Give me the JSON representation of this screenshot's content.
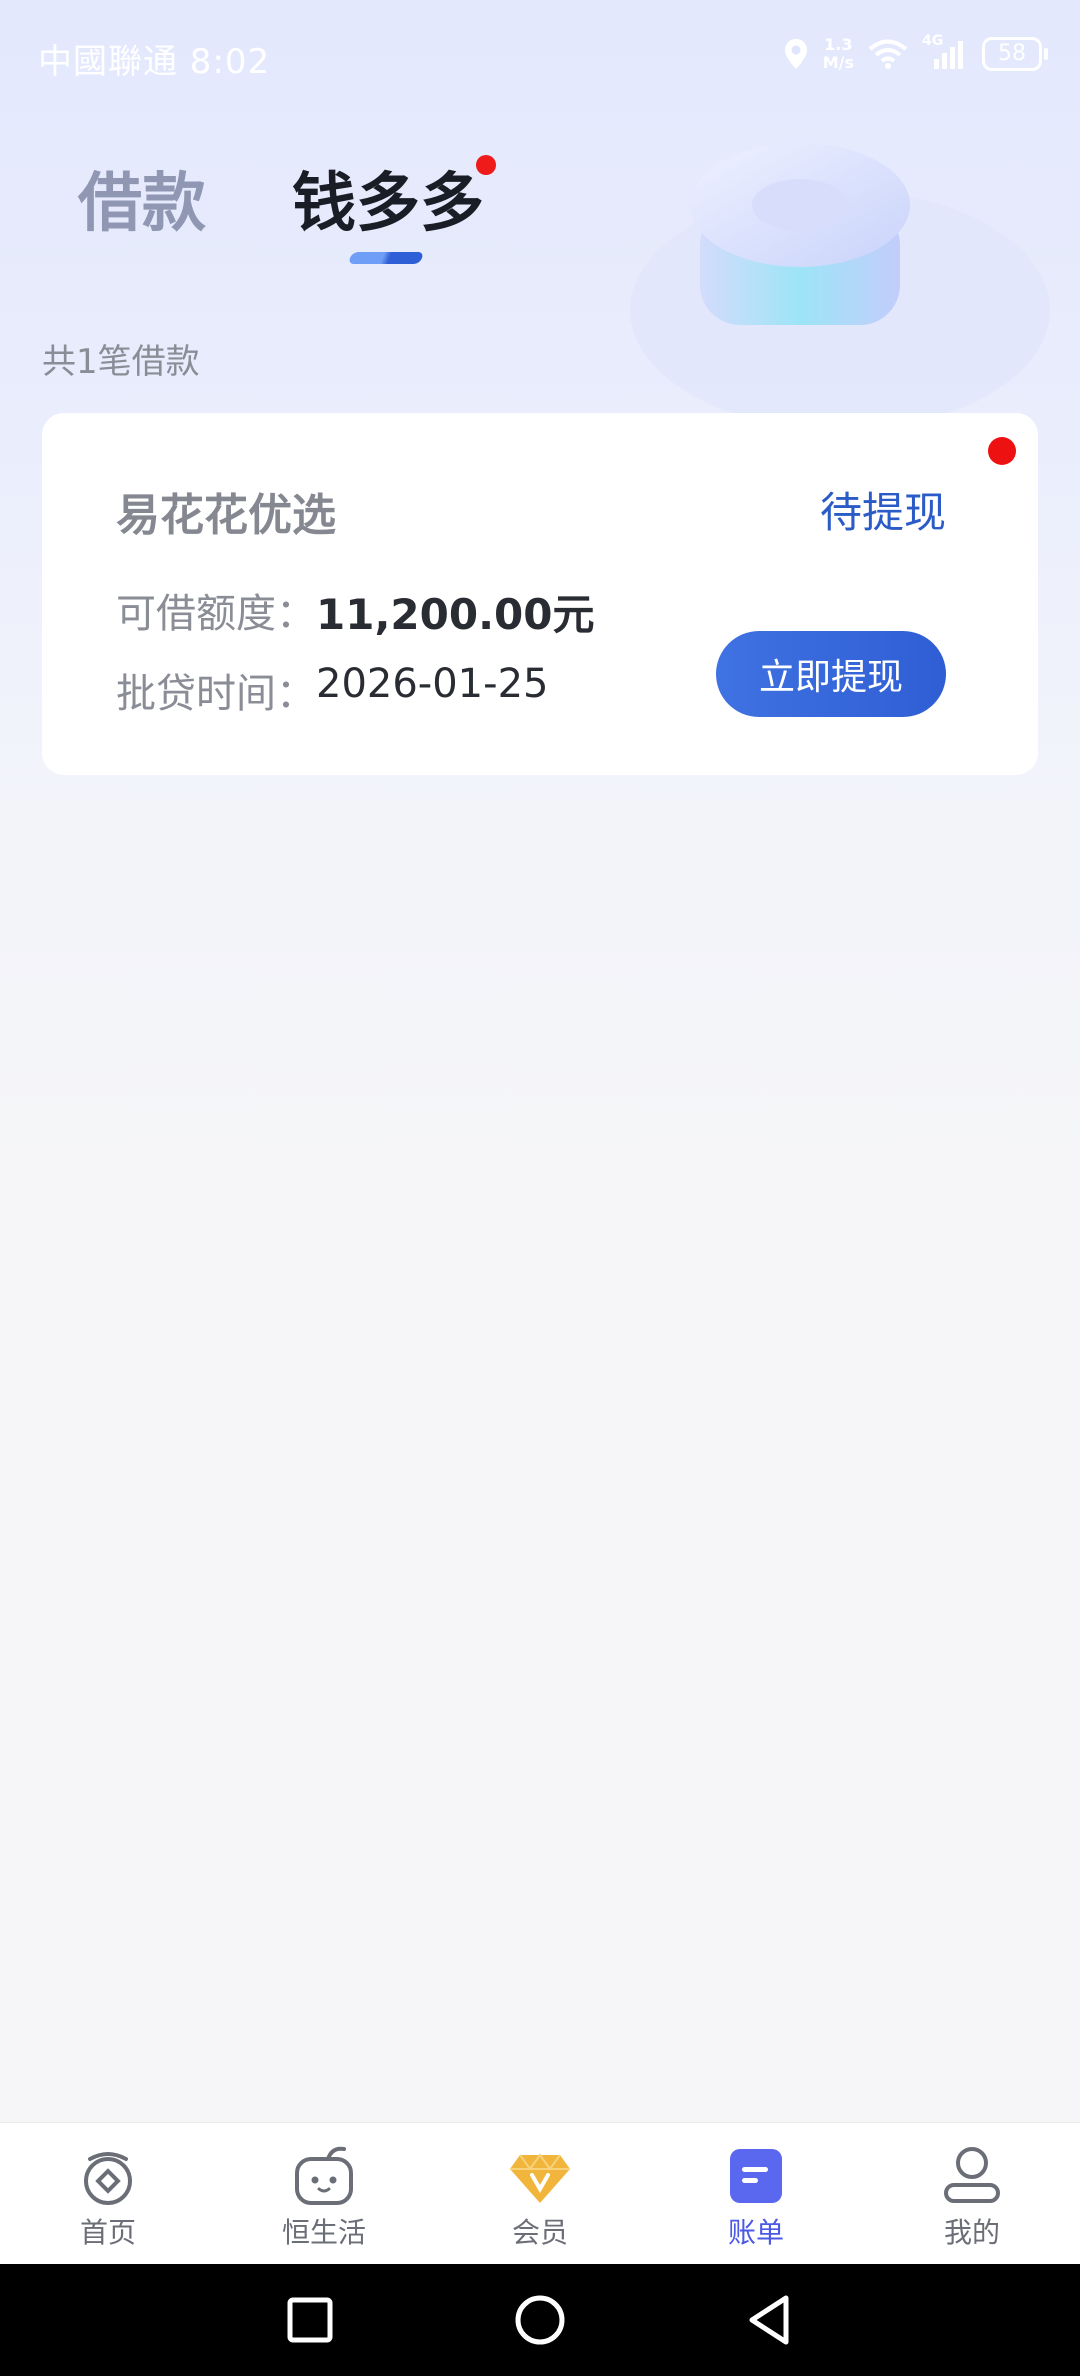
{
  "status_bar": {
    "carrier_time": "中國聯通 8:02",
    "net_speed_value": "1.3",
    "net_speed_unit": "M/s",
    "network": "4G",
    "battery": "58"
  },
  "tabs": [
    {
      "label": "借款",
      "active": false
    },
    {
      "label": "钱多多",
      "active": true,
      "has_dot": true
    }
  ],
  "loan_count_text": "共1笔借款",
  "loan_card": {
    "product": "易花花优选",
    "status": "待提现",
    "limit_label": "可借额度：",
    "limit_value": "11,200.00元",
    "date_label": "批贷时间：",
    "date_value": "2026-01-25",
    "button": "立即提现",
    "has_dot": true
  },
  "tabbar": [
    {
      "label": "首页",
      "icon": "home-icon"
    },
    {
      "label": "恒生活",
      "icon": "life-icon"
    },
    {
      "label": "会员",
      "icon": "vip-diamond-icon"
    },
    {
      "label": "账单",
      "icon": "bill-icon",
      "active": true
    },
    {
      "label": "我的",
      "icon": "profile-icon"
    }
  ],
  "colors": {
    "accent": "#2f5ed4",
    "tab_active": "#4b59e4",
    "dot": "#ee1111",
    "vip_gold": "#f0b53a"
  }
}
